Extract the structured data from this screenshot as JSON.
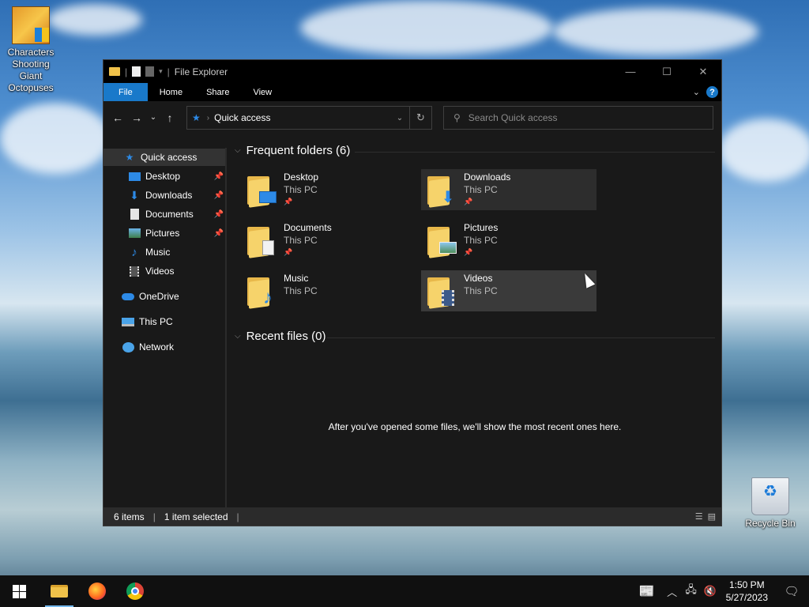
{
  "desktop": {
    "icons": [
      {
        "label": "Characters Shooting Giant Octopuses",
        "icon": "game-icon"
      },
      {
        "label": "Recycle Bin",
        "icon": "recycle-bin-icon"
      }
    ]
  },
  "window": {
    "title": "File Explorer",
    "ribbon_tabs": [
      "File",
      "Home",
      "Share",
      "View"
    ],
    "address": "Quick access",
    "search_placeholder": "Search Quick access",
    "sidebar": [
      {
        "label": "Quick access",
        "icon": "star-icon",
        "pinned": false
      },
      {
        "label": "Desktop",
        "icon": "desktop-icon",
        "pinned": true
      },
      {
        "label": "Downloads",
        "icon": "download-icon",
        "pinned": true
      },
      {
        "label": "Documents",
        "icon": "document-icon",
        "pinned": true
      },
      {
        "label": "Pictures",
        "icon": "picture-icon",
        "pinned": true
      },
      {
        "label": "Music",
        "icon": "music-icon",
        "pinned": false
      },
      {
        "label": "Videos",
        "icon": "video-icon",
        "pinned": false
      },
      {
        "label": "OneDrive",
        "icon": "cloud-icon",
        "pinned": false
      },
      {
        "label": "This PC",
        "icon": "computer-icon",
        "pinned": false
      },
      {
        "label": "Network",
        "icon": "network-icon",
        "pinned": false
      }
    ],
    "frequent_header": "Frequent folders (6)",
    "folders": [
      {
        "name": "Desktop",
        "location": "This PC",
        "pinned": true
      },
      {
        "name": "Downloads",
        "location": "This PC",
        "pinned": true
      },
      {
        "name": "Documents",
        "location": "This PC",
        "pinned": true
      },
      {
        "name": "Pictures",
        "location": "This PC",
        "pinned": true
      },
      {
        "name": "Music",
        "location": "This PC",
        "pinned": false
      },
      {
        "name": "Videos",
        "location": "This PC",
        "pinned": false
      }
    ],
    "recent_header": "Recent files (0)",
    "recent_empty_message": "After you've opened some files, we'll show the most recent ones here.",
    "status": {
      "items": "6 items",
      "selected": "1 item selected"
    }
  },
  "taskbar": {
    "time": "1:50 PM",
    "date": "5/27/2023"
  },
  "colors": {
    "accent": "#1979ca",
    "window_bg": "#191919",
    "taskbar_bg": "#101010"
  }
}
